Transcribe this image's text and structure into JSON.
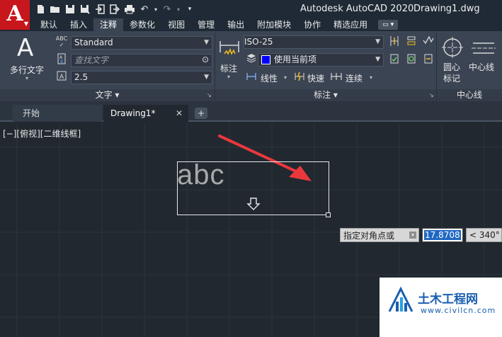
{
  "titlebar": {
    "app_logo": "A",
    "title": "Autodesk AutoCAD 2020",
    "filename": "Drawing1.dwg",
    "quick_access_icons": [
      "new-icon",
      "open-icon",
      "save-icon",
      "save-as-icon",
      "import-icon",
      "export-icon",
      "print-icon",
      "undo-icon",
      "redo-icon",
      "customize-icon"
    ]
  },
  "ribbon_tabs": [
    {
      "label": "默认",
      "active": false
    },
    {
      "label": "插入",
      "active": false
    },
    {
      "label": "注释",
      "active": true
    },
    {
      "label": "参数化",
      "active": false
    },
    {
      "label": "视图",
      "active": false
    },
    {
      "label": "管理",
      "active": false
    },
    {
      "label": "输出",
      "active": false
    },
    {
      "label": "附加模块",
      "active": false
    },
    {
      "label": "协作",
      "active": false
    },
    {
      "label": "精选应用",
      "active": false
    }
  ],
  "text_panel": {
    "big_letter": "A",
    "mtext_label": "多行文字",
    "style_value": "Standard",
    "find_placeholder": "查找文字",
    "height_value": "2.5",
    "footer": "文字 ▾"
  },
  "dim_panel": {
    "dim_label": "标注",
    "dim_style_value": "ISO-25",
    "layer_value": "使用当前项",
    "layer_color": "#0000ff",
    "linear_label": "线性",
    "quick_label": "快速",
    "continue_label": "连续",
    "footer": "标注 ▾"
  },
  "centerline_panel": {
    "center_mark_label": "圆心\n标记",
    "center_mark_line1": "圆心",
    "center_mark_line2": "标记",
    "centerline_label": "中心线",
    "footer": "中心线"
  },
  "file_tabs": {
    "start_label": "开始",
    "doc_label": "Drawing1*",
    "close_glyph": "✕",
    "new_glyph": "+"
  },
  "viewport": {
    "view_controls": "[−][俯视][二维线框]",
    "mtext_content": "abc",
    "prompt_text": "指定对角点或",
    "value_input": "17.8708",
    "angle_value": "< 340°",
    "accent_arrow_color": "#e8383d"
  },
  "watermark": {
    "name": "土木工程网",
    "url": "www.civilcn.com"
  }
}
